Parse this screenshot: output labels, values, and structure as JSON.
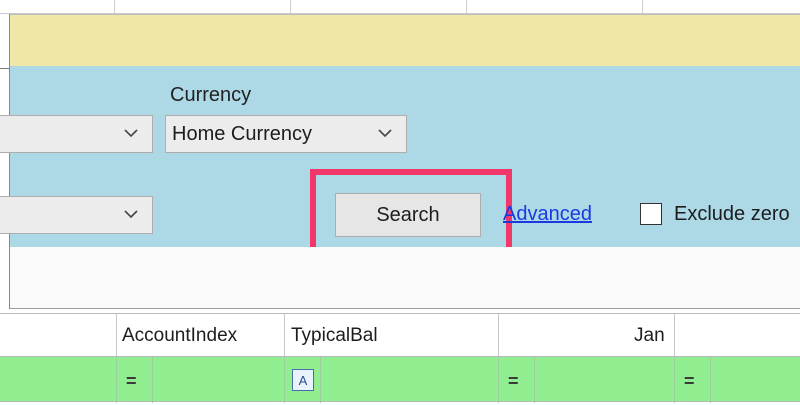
{
  "filters": {
    "currency_label": "Currency",
    "currency_value": "Home Currency",
    "dropdown_1_value": "",
    "dropdown_2_value": ""
  },
  "actions": {
    "search_label": "Search",
    "advanced_link": "Advanced",
    "exclude_zero_label": "Exclude zero",
    "exclude_zero_checked": false
  },
  "grid": {
    "columns": [
      {
        "header": "AccountIndex"
      },
      {
        "header": "TypicalBal"
      },
      {
        "header": "Jan"
      }
    ],
    "filter_ops": [
      "=",
      "=",
      "=",
      "="
    ],
    "text_filter_icon": "A"
  },
  "colors": {
    "form_background": "#add8e6",
    "top_band": "#efe7a6",
    "filter_row": "#90ee90",
    "highlight": "#f2386a",
    "link": "#1a3ae0"
  },
  "icons": [
    "chevron-down-icon",
    "text-filter-icon"
  ]
}
